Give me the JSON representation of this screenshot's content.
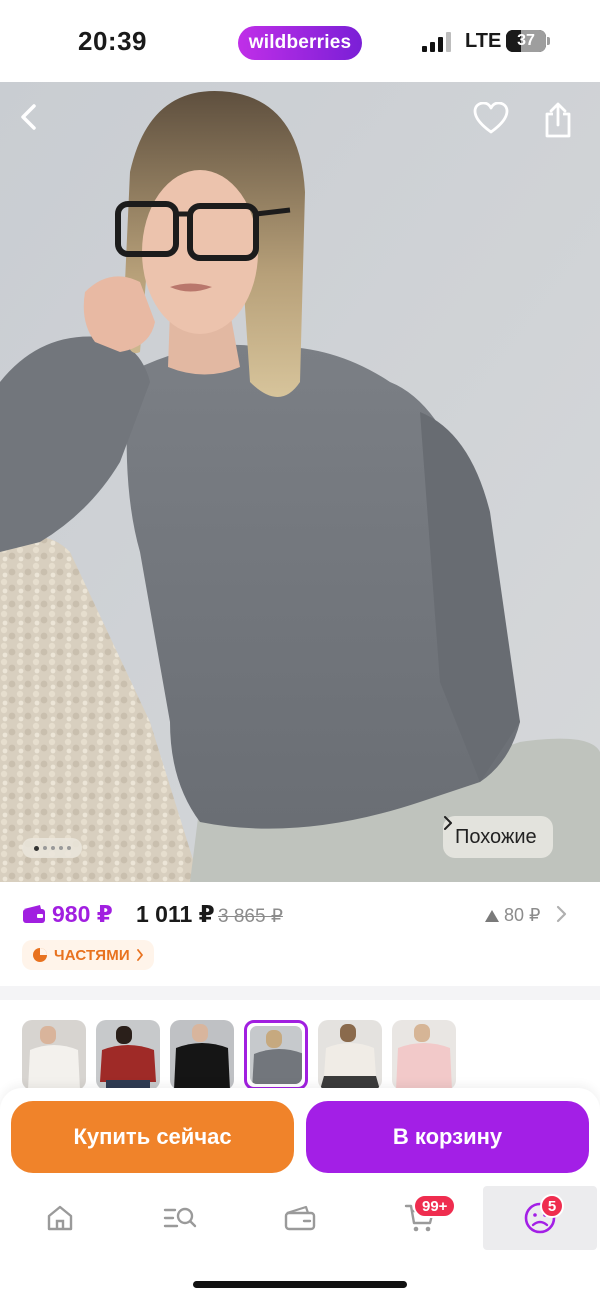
{
  "status_bar": {
    "time": "20:39",
    "brand_pill": "wildberries",
    "network": "LTE",
    "battery_percent": "37",
    "battery_level": 0.37
  },
  "hero": {
    "back_icon": "chevron-left-icon",
    "favorite_icon": "heart-icon",
    "share_icon": "share-icon",
    "similar_label": "Похожие",
    "image_count": 5,
    "active_image_index": 0
  },
  "price": {
    "wallet_price": "980 ₽",
    "price": "1 011 ₽",
    "old_price": "3 865 ₽",
    "price_difference": "80 ₽",
    "installment_label": "ЧАСТЯМИ"
  },
  "variants": {
    "count": 6,
    "selected_index": 3
  },
  "actions": {
    "buy_now": "Купить сейчас",
    "add_to_cart": "В корзину"
  },
  "tabbar": {
    "items": [
      {
        "icon": "home-icon"
      },
      {
        "icon": "search-catalog-icon"
      },
      {
        "icon": "wallet-icon"
      },
      {
        "icon": "cart-icon",
        "badge": "99+"
      },
      {
        "icon": "profile-icon",
        "badge": "5"
      }
    ],
    "active_index": 4
  },
  "colors": {
    "brand_purple": "#a31fe6",
    "buy_orange": "#f0832a",
    "price_purple": "#a11fe0",
    "badge_red": "#ef2d4f"
  }
}
